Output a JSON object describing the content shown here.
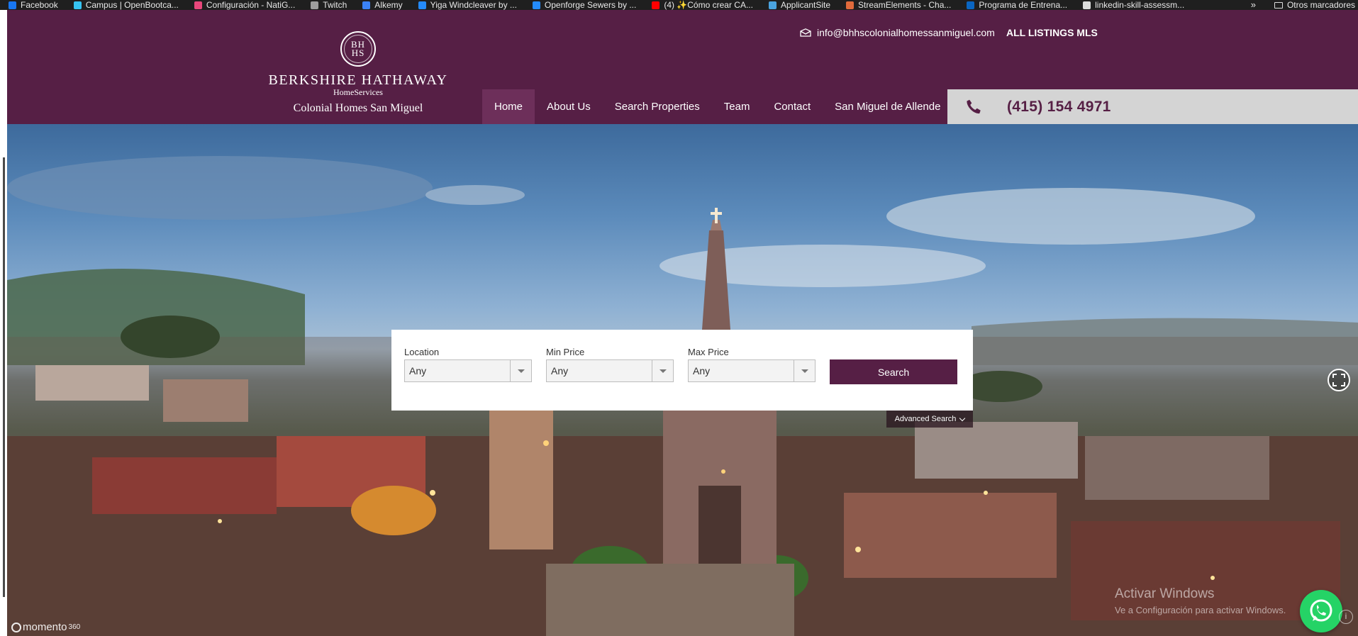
{
  "bookmarks": {
    "items": [
      {
        "label": "Facebook",
        "icon": "facebook-icon",
        "color": "#1877f2"
      },
      {
        "label": "Campus | OpenBootca...",
        "icon": "campus-icon",
        "color": "#36c4f2"
      },
      {
        "label": "Configuración - NatiG...",
        "icon": "natig-icon",
        "color": "#e8477b"
      },
      {
        "label": "Twitch",
        "icon": "globe-icon",
        "color": "#9e9e9e"
      },
      {
        "label": "Alkemy",
        "icon": "alkemy-icon",
        "color": "#3b82f6"
      },
      {
        "label": "Yiga Windcleaver by ...",
        "icon": "thingiverse-icon",
        "color": "#248bfb"
      },
      {
        "label": "Openforge Sewers by ...",
        "icon": "thingiverse-icon",
        "color": "#248bfb"
      },
      {
        "label": "(4) ✨Cómo crear CA...",
        "icon": "youtube-icon",
        "color": "#ff0000"
      },
      {
        "label": "ApplicantSite",
        "icon": "applicantsite-icon",
        "color": "#4aa3df"
      },
      {
        "label": "StreamElements - Cha...",
        "icon": "streamelements-icon",
        "color": "#e06a3b"
      },
      {
        "label": "Programa de Entrena...",
        "icon": "linkedin-icon",
        "color": "#0a66c2"
      },
      {
        "label": "linkedin-skill-assessm...",
        "icon": "github-icon",
        "color": "#dddddd"
      }
    ],
    "more": "»",
    "other": "Otros marcadores"
  },
  "header": {
    "seal_top": "BH",
    "seal_bottom": "HS",
    "brand_name": "BERKSHIRE HATHAWAY",
    "brand_sub": "HomeServices",
    "brand_office": "Colonial Homes San Miguel",
    "email": "info@bhhscolonialhomessanmiguel.com",
    "listings": "ALL LISTINGS MLS",
    "nav": [
      "Home",
      "About Us",
      "Search Properties",
      "Team",
      "Contact",
      "San Miguel de Allende"
    ],
    "phone": "(415) 154 4971",
    "colors": {
      "brand": "#561f45",
      "nav_active": "#6d2f5a",
      "phone_bg": "#d4d4d4"
    }
  },
  "search": {
    "location_label": "Location",
    "location_value": "Any",
    "min_price_label": "Min Price",
    "min_price_value": "Any",
    "max_price_label": "Max Price",
    "max_price_value": "Any",
    "button": "Search",
    "advanced": "Advanced Search"
  },
  "hero": {
    "momento_brand": "momento",
    "momento_suffix": "360",
    "activate_title": "Activar Windows",
    "activate_sub": "Ve a Configuración para activar Windows."
  }
}
